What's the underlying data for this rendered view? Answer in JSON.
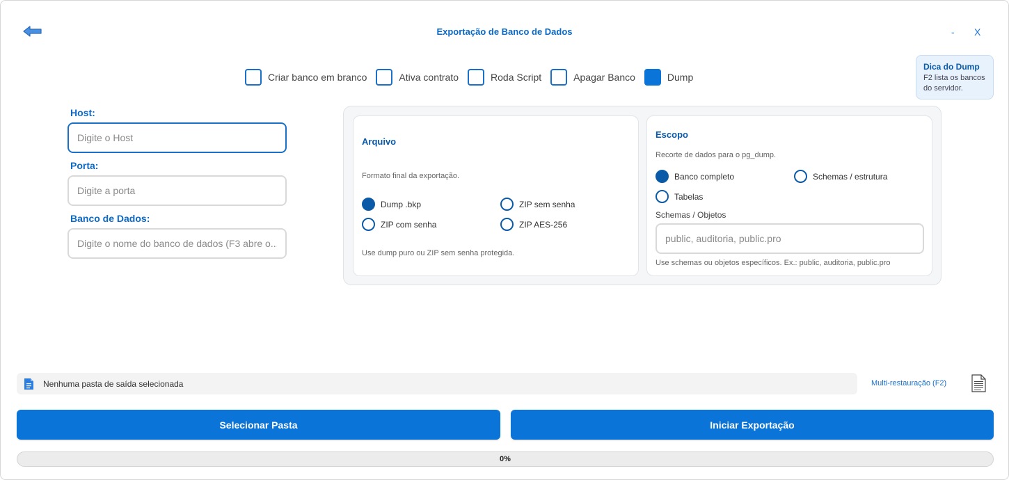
{
  "header": {
    "title": "Exportação de Banco de Dados",
    "minimize_label": "-",
    "close_label": "X",
    "back_icon": "arrow-left-icon"
  },
  "top_options": [
    {
      "label": "Criar banco em branco",
      "checked": false
    },
    {
      "label": "Ativa contrato",
      "checked": false
    },
    {
      "label": "Roda Script",
      "checked": false
    },
    {
      "label": "Apagar Banco",
      "checked": false
    },
    {
      "label": "Dump",
      "checked": true
    }
  ],
  "tip": {
    "title": "Dica do Dump",
    "text": "F2 lista os bancos do servidor."
  },
  "fields": {
    "host": {
      "label": "Host:",
      "placeholder": "Digite o Host",
      "value": ""
    },
    "porta": {
      "label": "Porta:",
      "placeholder": "Digite a porta",
      "value": ""
    },
    "banco": {
      "label": "Banco de Dados:",
      "placeholder": "Digite o nome do banco de dados (F3 abre o...",
      "value": ""
    }
  },
  "arquivo": {
    "title": "Arquivo",
    "subtitle": "Formato final da exportação.",
    "options": [
      {
        "label": "Dump .bkp",
        "checked": true
      },
      {
        "label": "ZIP sem senha",
        "checked": false
      },
      {
        "label": "ZIP com senha",
        "checked": false
      },
      {
        "label": "ZIP AES-256",
        "checked": false
      }
    ],
    "hint": "Use dump puro ou ZIP sem senha protegida."
  },
  "escopo": {
    "title": "Escopo",
    "subtitle": "Recorte de dados para o pg_dump.",
    "options": [
      {
        "label": "Banco completo",
        "checked": true
      },
      {
        "label": "Schemas / estrutura",
        "checked": false
      },
      {
        "label": "Tabelas",
        "checked": false
      }
    ],
    "objects_label": "Schemas / Objetos",
    "objects_placeholder": "public, auditoria, public.pro",
    "objects_value": "",
    "hint": "Use schemas ou objetos específicos. Ex.: public, auditoria, public.pro"
  },
  "output": {
    "folder_text": "Nenhuma pasta de saída selecionada",
    "multi_link": "Multi-restauração (F2)"
  },
  "actions": {
    "select_folder": "Selecionar Pasta",
    "start_export": "Iniciar Exportação"
  },
  "progress": {
    "value": 0,
    "label": "0%"
  },
  "colors": {
    "accent": "#0b74d9",
    "title": "#0b69c7",
    "tip_bg": "#e8f2fd"
  }
}
